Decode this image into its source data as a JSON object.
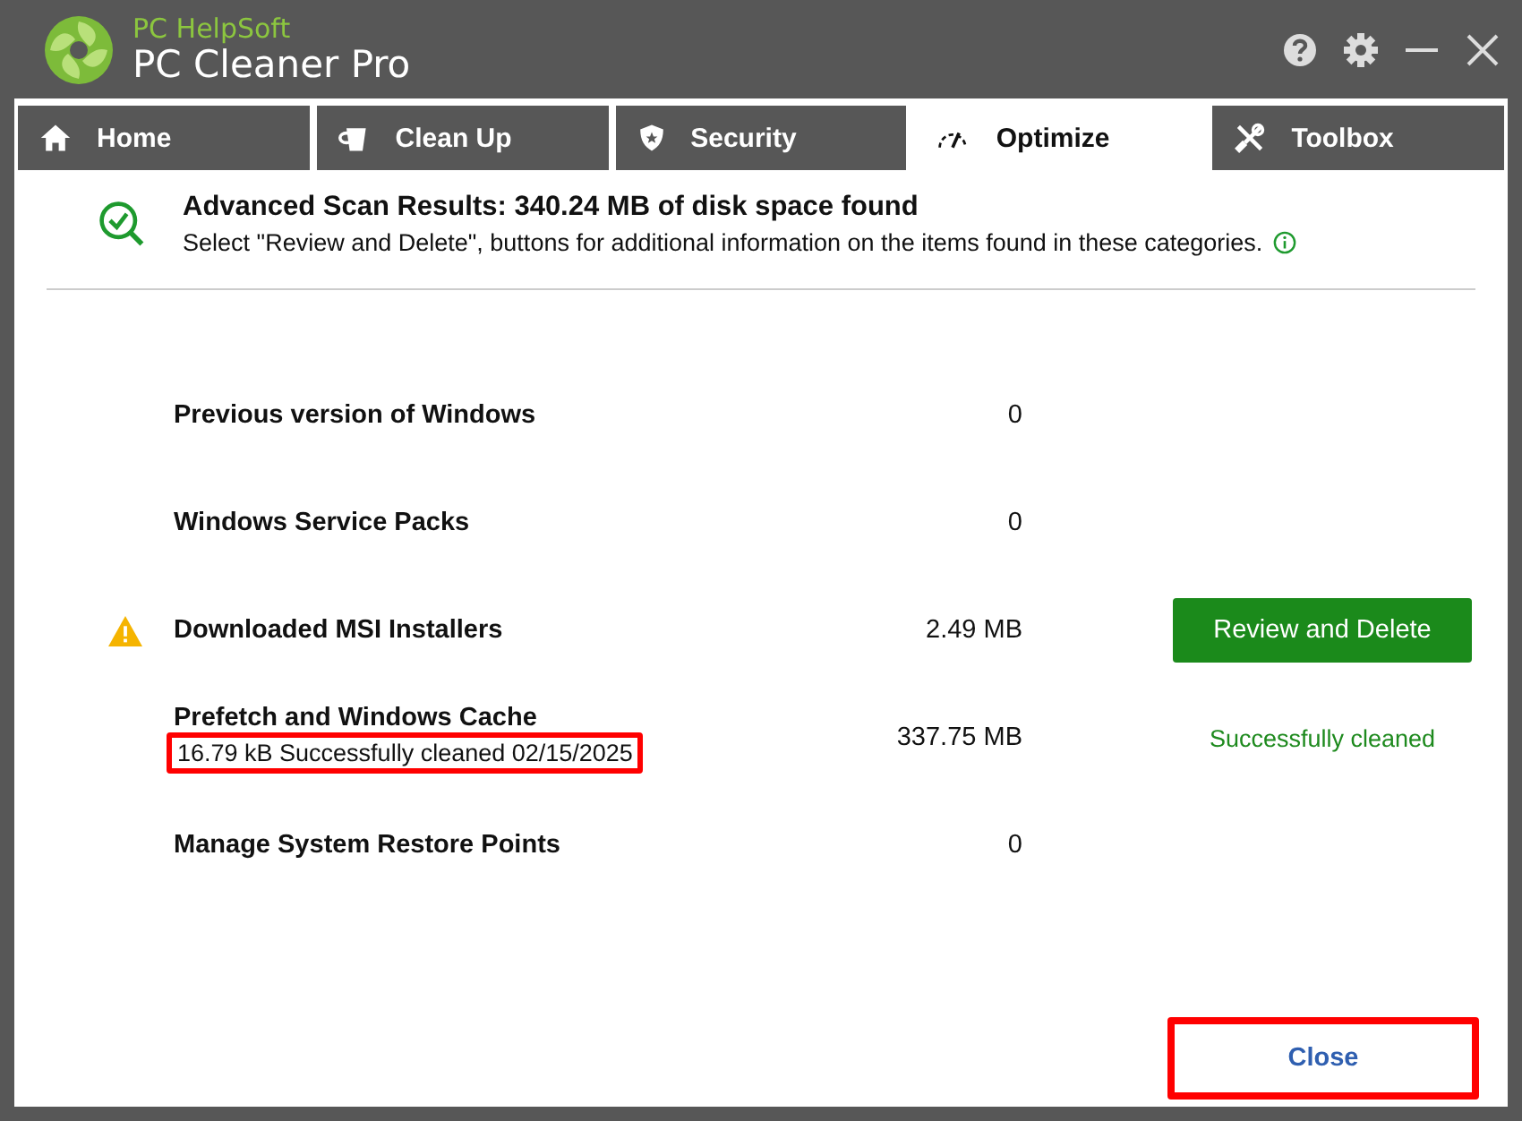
{
  "window": {
    "brand": "PC HelpSoft",
    "title": "PC Cleaner Pro"
  },
  "title_buttons": [
    {
      "kind": "help"
    },
    {
      "kind": "settings"
    },
    {
      "kind": "minimize"
    },
    {
      "kind": "close"
    }
  ],
  "tabs": [
    {
      "label": "Home",
      "kind": "home",
      "selected": false
    },
    {
      "label": "Clean Up",
      "kind": "cleanup",
      "selected": false
    },
    {
      "label": "Security",
      "kind": "security",
      "selected": false
    },
    {
      "label": "Optimize",
      "kind": "optimize",
      "selected": true
    },
    {
      "label": "Toolbox",
      "kind": "toolbox",
      "selected": false
    }
  ],
  "summary": {
    "heading": "Advanced Scan Results: 340.24 MB of disk space found",
    "text": "Select \"Review and Delete\", buttons for additional information on the items found in these categories."
  },
  "rows": [
    {
      "name": "Previous version of Windows",
      "size": "0",
      "warning": false
    },
    {
      "name": "Windows Service Packs",
      "size": "0",
      "warning": false
    },
    {
      "name": "Downloaded MSI Installers",
      "size": "2.49 MB",
      "warning": true,
      "action": {
        "kind": "button",
        "label": "Review and Delete"
      }
    },
    {
      "name": "Prefetch and Windows Cache",
      "size": "337.75 MB",
      "warning": false,
      "detail": {
        "text": "16.79 kB Successfully cleaned 02/15/2025",
        "highlighted": true
      },
      "action": {
        "kind": "status",
        "label": "Successfully cleaned"
      }
    },
    {
      "name": "Manage System Restore Points",
      "size": "0",
      "warning": false
    }
  ],
  "close_button": {
    "label": "Close",
    "highlighted": true
  }
}
